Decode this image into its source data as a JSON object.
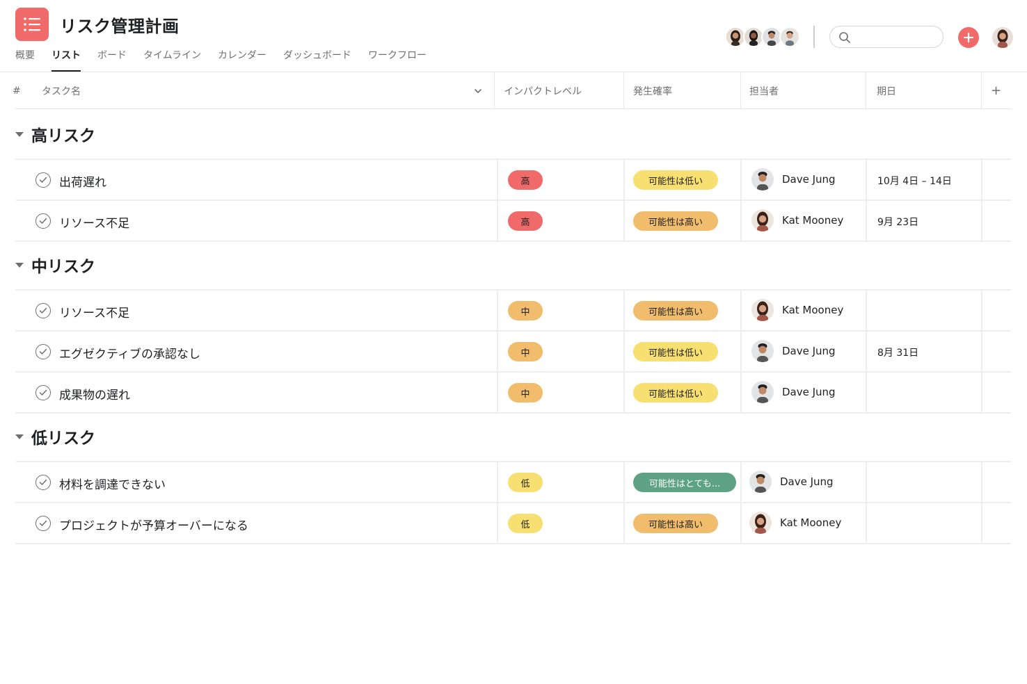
{
  "project": {
    "title": "リスク管理計画",
    "icon": "list-icon",
    "brand_color": "#f06a6a"
  },
  "tabs": [
    {
      "label": "概要",
      "active": false
    },
    {
      "label": "リスト",
      "active": true
    },
    {
      "label": "ボード",
      "active": false
    },
    {
      "label": "タイムライン",
      "active": false
    },
    {
      "label": "カレンダー",
      "active": false
    },
    {
      "label": "ダッシュボード",
      "active": false
    },
    {
      "label": "ワークフロー",
      "active": false
    }
  ],
  "search": {
    "placeholder": "",
    "value": ""
  },
  "columns": {
    "number": "#",
    "task_name": "タスク名",
    "impact": "インパクトレベル",
    "probability": "発生確率",
    "assignee": "担当者",
    "due": "期日",
    "add": "+"
  },
  "colors": {
    "high": "#f06a6a",
    "medium": "#f1bd6c",
    "low": "#f8df72",
    "green": "#5da283"
  },
  "sections": [
    {
      "title": "高リスク",
      "tasks": [
        {
          "name": "出荷遅れ",
          "impact": "高",
          "probability": "可能性は低い",
          "assignee": "Dave Jung",
          "due": "10月 4日 – 14日"
        },
        {
          "name": "リソース不足",
          "impact": "高",
          "probability": "可能性は高い",
          "assignee": "Kat Mooney",
          "due": "9月 23日"
        }
      ]
    },
    {
      "title": "中リスク",
      "tasks": [
        {
          "name": "リソース不足",
          "impact": "中",
          "probability": "可能性は高い",
          "assignee": "Kat Mooney",
          "due": ""
        },
        {
          "name": "エグゼクティブの承認なし",
          "impact": "中",
          "probability": "可能性は低い",
          "assignee": "Dave Jung",
          "due": "8月 31日"
        },
        {
          "name": "成果物の遅れ",
          "impact": "中",
          "probability": "可能性は低い",
          "assignee": "Dave Jung",
          "due": ""
        }
      ]
    },
    {
      "title": "低リスク",
      "tasks": [
        {
          "name": "材料を調達できない",
          "impact": "低",
          "probability": "可能性はとても...",
          "assignee": "Dave Jung",
          "due": ""
        },
        {
          "name": "プロジェクトが予算オーバーになる",
          "impact": "低",
          "probability": "可能性は高い",
          "assignee": "Kat Mooney",
          "due": ""
        }
      ]
    }
  ]
}
